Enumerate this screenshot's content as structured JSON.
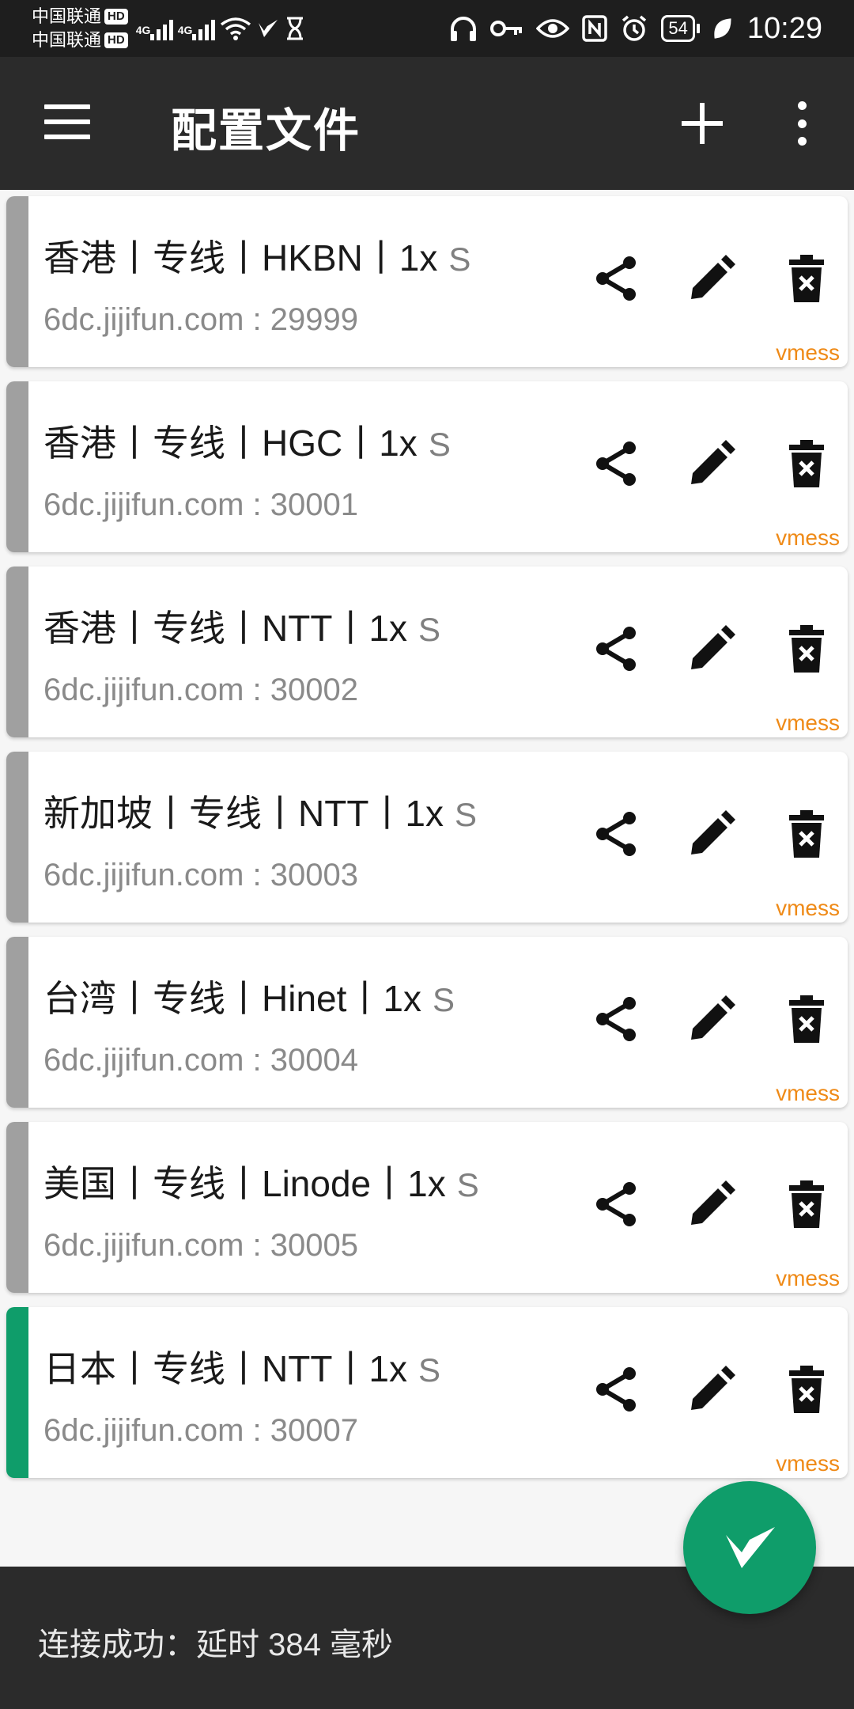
{
  "status_bar": {
    "carrier1": "中国联通",
    "carrier2": "中国联通",
    "hd": "HD",
    "net1": "4G",
    "net2": "4G",
    "battery": "54",
    "time": "10:29"
  },
  "app_bar": {
    "title": "配置文件"
  },
  "profiles": [
    {
      "title": "香港丨专线丨HKBN丨1x",
      "suffix": "S",
      "address": "6dc.jijifun.com : 29999",
      "type": "vmess"
    },
    {
      "title": "香港丨专线丨HGC丨1x",
      "suffix": "S",
      "address": "6dc.jijifun.com : 30001",
      "type": "vmess"
    },
    {
      "title": "香港丨专线丨NTT丨1x",
      "suffix": "S",
      "address": "6dc.jijifun.com : 30002",
      "type": "vmess"
    },
    {
      "title": "新加坡丨专线丨NTT丨1x",
      "suffix": "S",
      "address": "6dc.jijifun.com : 30003",
      "type": "vmess"
    },
    {
      "title": "台湾丨专线丨Hinet丨1x",
      "suffix": "S",
      "address": "6dc.jijifun.com : 30004",
      "type": "vmess"
    },
    {
      "title": "美国丨专线丨Linode丨1x",
      "suffix": "S",
      "address": "6dc.jijifun.com : 30005",
      "type": "vmess"
    },
    {
      "title": "日本丨专线丨NTT丨1x",
      "suffix": "S",
      "address": "6dc.jijifun.com : 30007",
      "type": "vmess",
      "selected": true
    }
  ],
  "bottom_bar": {
    "status": "连接成功：延时 384 毫秒"
  },
  "colors": {
    "accent": "#0f9d6a",
    "type_label": "#ef8a17",
    "inactive_strip": "#a0a0a0",
    "bar_bg": "#2b2b2b"
  }
}
